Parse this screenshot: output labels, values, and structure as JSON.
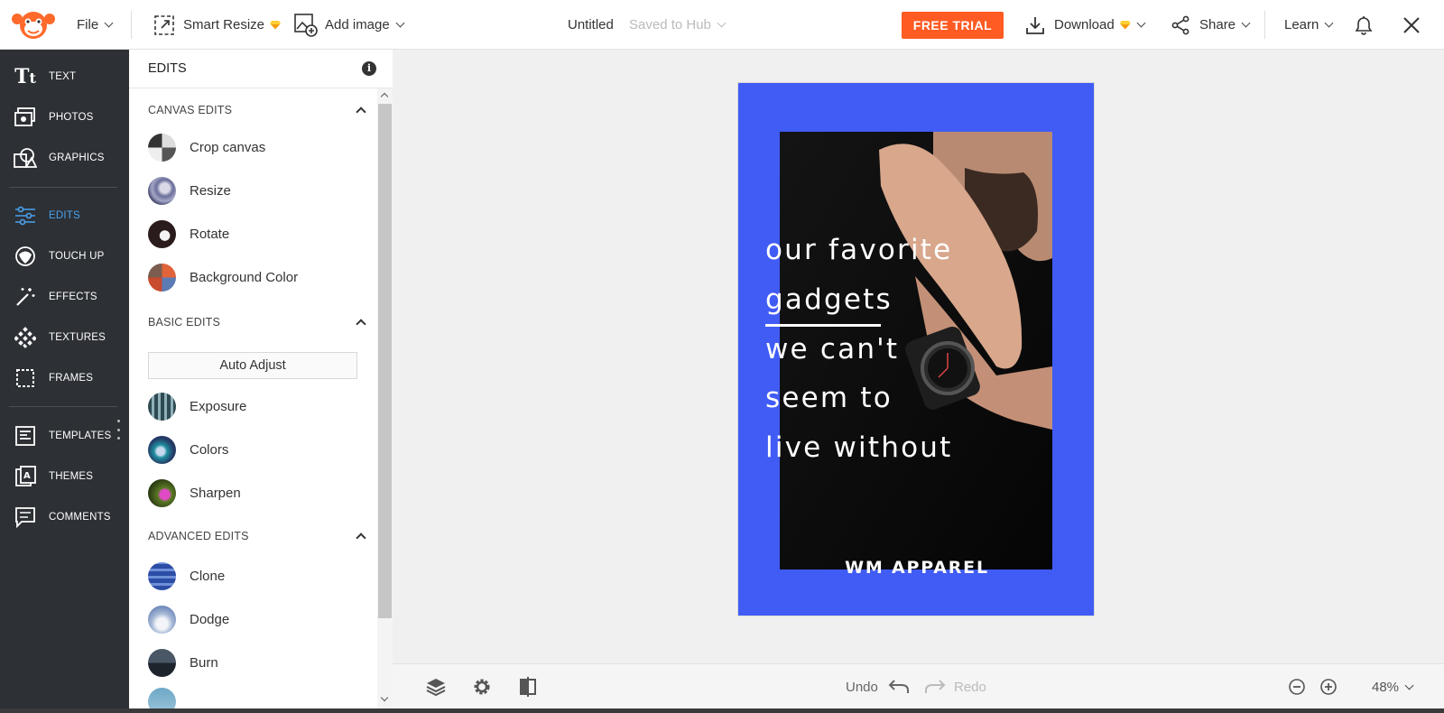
{
  "topbar": {
    "file_label": "File",
    "smart_resize_label": "Smart Resize",
    "add_image_label": "Add image",
    "doc_title": "Untitled",
    "save_status": "Saved to Hub",
    "free_trial_label": "FREE TRIAL",
    "download_label": "Download",
    "share_label": "Share",
    "learn_label": "Learn"
  },
  "rail": {
    "items": [
      {
        "label": "TEXT",
        "icon": "text-icon"
      },
      {
        "label": "PHOTOS",
        "icon": "photos-icon"
      },
      {
        "label": "GRAPHICS",
        "icon": "graphics-icon"
      },
      {
        "label": "EDITS",
        "icon": "edits-icon",
        "active": true
      },
      {
        "label": "TOUCH UP",
        "icon": "touch-up-icon"
      },
      {
        "label": "EFFECTS",
        "icon": "effects-icon"
      },
      {
        "label": "TEXTURES",
        "icon": "textures-icon"
      },
      {
        "label": "FRAMES",
        "icon": "frames-icon"
      },
      {
        "label": "TEMPLATES",
        "icon": "templates-icon"
      },
      {
        "label": "THEMES",
        "icon": "themes-icon"
      },
      {
        "label": "COMMENTS",
        "icon": "comments-icon"
      }
    ]
  },
  "panel": {
    "title": "EDITS",
    "canvas_edits": {
      "heading": "CANVAS EDITS",
      "items": [
        "Crop canvas",
        "Resize",
        "Rotate",
        "Background Color"
      ]
    },
    "basic_edits": {
      "heading": "BASIC EDITS",
      "auto_adjust_label": "Auto Adjust",
      "items": [
        "Exposure",
        "Colors",
        "Sharpen"
      ]
    },
    "advanced_edits": {
      "heading": "ADVANCED EDITS",
      "items": [
        "Clone",
        "Dodge",
        "Burn"
      ]
    }
  },
  "poster": {
    "lines": [
      "our favorite",
      "gadgets",
      "we can't",
      "seem to",
      "live without"
    ],
    "brand": "WM APPAREL",
    "background_color": "#405cf5"
  },
  "bottombar": {
    "undo_label": "Undo",
    "redo_label": "Redo",
    "zoom_level": "48%"
  },
  "colors": {
    "accent": "#ff5b23",
    "rail_bg": "#2d3035",
    "active": "#4aa3f0"
  }
}
